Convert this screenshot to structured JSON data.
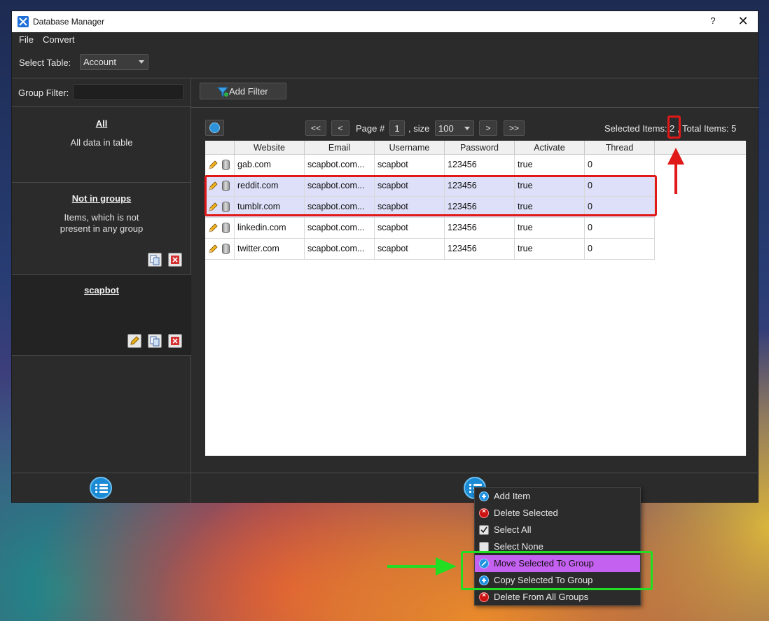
{
  "window": {
    "title": "Database Manager",
    "help": "?",
    "close": "✕"
  },
  "menu": {
    "file": "File",
    "convert": "Convert"
  },
  "toolbar": {
    "select_table_label": "Select Table:",
    "select_table_value": "Account"
  },
  "left_panel": {
    "group_filter_label": "Group Filter:",
    "groups": [
      {
        "title": "All",
        "description": "All data in table"
      },
      {
        "title": "Not in groups",
        "description_line1": "Items, which is not",
        "description_line2": "present in any group"
      },
      {
        "title": "scapbot"
      }
    ]
  },
  "right_panel": {
    "add_filter": "Add Filter",
    "pager": {
      "first": "<<",
      "prev": "<",
      "page_label": "Page #",
      "page": "1",
      "size_label": ", size",
      "size": "100",
      "next": ">",
      "last": ">>"
    },
    "selected_label": "Selected Items:",
    "selected_count": "2",
    "total_label": ", Total Items:  5"
  },
  "table": {
    "columns": [
      "Website",
      "Email",
      "Username",
      "Password",
      "Activate",
      "Thread"
    ],
    "rows": [
      {
        "website": "gab.com",
        "email": "scapbot.com...",
        "username": "scapbot",
        "password": "123456",
        "activate": "true",
        "thread": "0",
        "selected": false
      },
      {
        "website": "reddit.com",
        "email": "scapbot.com...",
        "username": "scapbot",
        "password": "123456",
        "activate": "true",
        "thread": "0",
        "selected": true
      },
      {
        "website": "tumblr.com",
        "email": "scapbot.com...",
        "username": "scapbot",
        "password": "123456",
        "activate": "true",
        "thread": "0",
        "selected": true
      },
      {
        "website": "linkedin.com",
        "email": "scapbot.com...",
        "username": "scapbot",
        "password": "123456",
        "activate": "true",
        "thread": "0",
        "selected": false
      },
      {
        "website": "twitter.com",
        "email": "scapbot.com...",
        "username": "scapbot",
        "password": "123456",
        "activate": "true",
        "thread": "0",
        "selected": false
      }
    ]
  },
  "context_menu": {
    "items": [
      {
        "label": "Add Item",
        "icon": "add-icon"
      },
      {
        "label": "Delete Selected",
        "icon": "delete-icon"
      },
      {
        "label": "Select All",
        "icon": "checkbox-checked-icon"
      },
      {
        "label": "Select None",
        "icon": "checkbox-empty-icon"
      },
      {
        "label": "Move Selected To Group",
        "icon": "move-icon",
        "highlighted": true
      },
      {
        "label": "Copy Selected To Group",
        "icon": "add-icon"
      },
      {
        "label": "Delete From All Groups",
        "icon": "delete-icon"
      }
    ]
  },
  "colors": {
    "highlight": "#c561f0",
    "annotation_red": "#e01818",
    "annotation_green": "#22dd22",
    "selection_row": "#dde0f8"
  }
}
